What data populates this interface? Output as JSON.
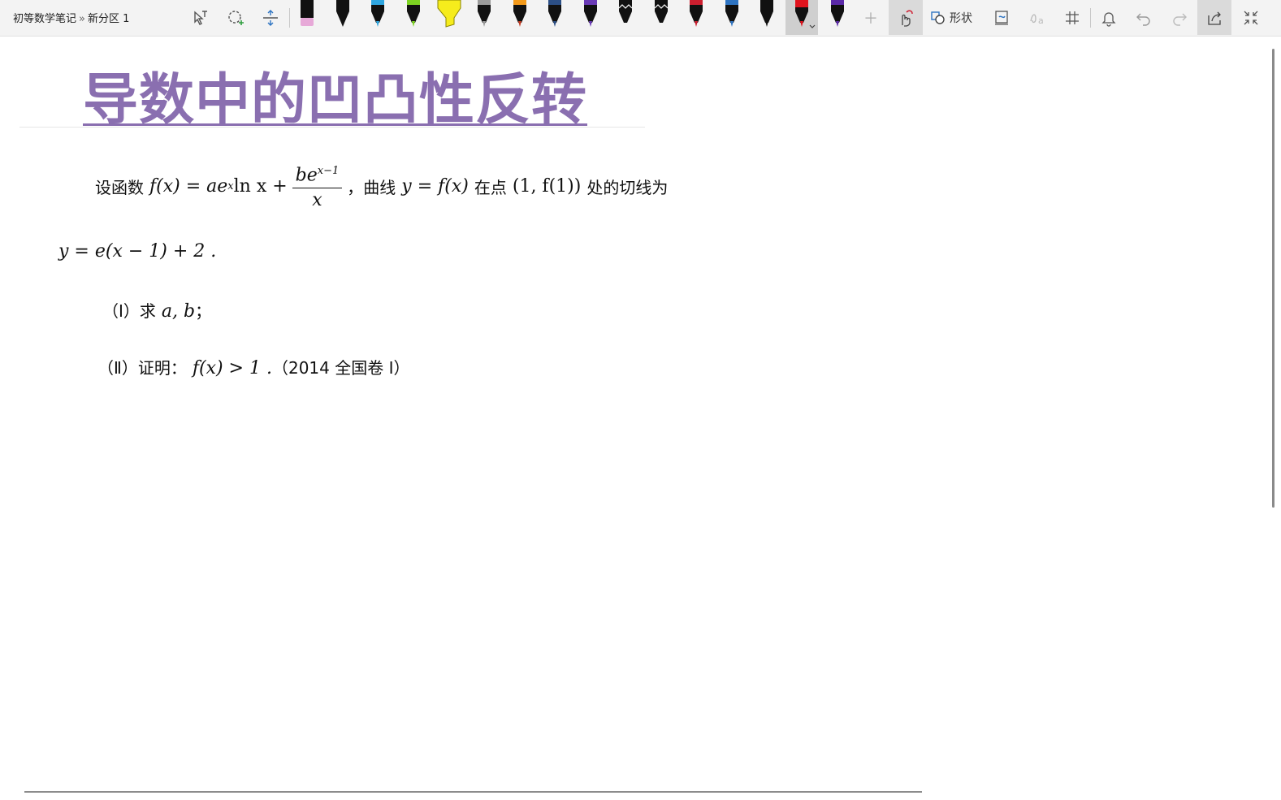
{
  "breadcrumb": {
    "notebook": "初等数学笔记",
    "separator": "»",
    "section": "新分区 1"
  },
  "toolbar": {
    "shapes_label": "形状",
    "pen_colors": [
      "#e7a9d8",
      "#111111",
      "#2fa6e0",
      "#7dd322",
      "#f6ec1c",
      "#9a9a9a",
      "#f39a1b",
      "#2c4f86",
      "#6a3bb6",
      "#111111",
      "#111111",
      "#cc1f2f",
      "#2e74c2",
      "#111111",
      "#e0131d",
      "#5b2aa8"
    ],
    "selected_pen_index": 14
  },
  "note": {
    "title": "导数中的凹凸性反转",
    "problem": {
      "intro": "设函数",
      "fx": "f(x) = ae",
      "exp_x": "x",
      "ln_part": " ln x +",
      "frac_num": "be",
      "frac_num_exp": "x−1",
      "frac_den": "x",
      "comma": "，",
      "curve_label": "曲线",
      "curve": "y = f(x)",
      "at_point": "在点",
      "point": "(1, f(1))",
      "tangent_label": "处的切线为",
      "tangent_line": "y = e(x − 1) + 2 .",
      "part1_label": "（Ⅰ）求",
      "part1_vars": "a, b",
      "part1_end": "；",
      "part2_label": "（Ⅱ）证明：",
      "part2_expr": "f(x) > 1 .",
      "part2_source": "（2014 全国卷 I）"
    }
  }
}
